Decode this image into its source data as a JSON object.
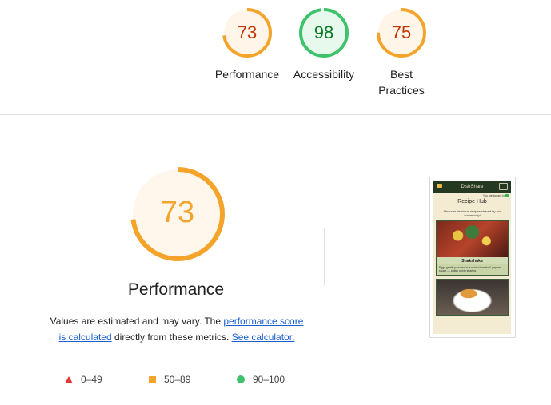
{
  "summary_gauges": [
    {
      "score": "73",
      "label": "Performance",
      "color": "#c33300",
      "ring": "#f4a42a",
      "fill": "#fff5e8",
      "fraction": 0.73
    },
    {
      "score": "98",
      "label": "Accessibility",
      "color": "#0c7a2a",
      "ring": "#3ec26b",
      "fill": "#e7f8ec",
      "fraction": 0.98
    },
    {
      "score": "75",
      "label_line1": "Best",
      "label_line2": "Practices",
      "color": "#c33300",
      "ring": "#f4a42a",
      "fill": "#fff5e8",
      "fraction": 0.75
    }
  ],
  "main": {
    "score": "73",
    "fraction": 0.73,
    "ring": "#f4a42a",
    "score_color": "#f4a42a",
    "fill": "#fff7ec",
    "title": "Performance",
    "desc_part1": "Values are estimated and may vary. The ",
    "link1": "performance score is calculated",
    "desc_part2": " directly from these metrics. ",
    "link2": "See calculator."
  },
  "legend": {
    "fail": "0–49",
    "average": "50–89",
    "pass": "90–100"
  },
  "screenshot": {
    "app_name": "DishShare",
    "login_text": "You are logged in",
    "heading": "Recipe Hub",
    "description": "Discover delicious recipes shared by our community!",
    "card_title": "Shakshuka",
    "card_text": "Eggs gently poached in a spiced tomato & pepper sauce — a dish worth sharing."
  }
}
